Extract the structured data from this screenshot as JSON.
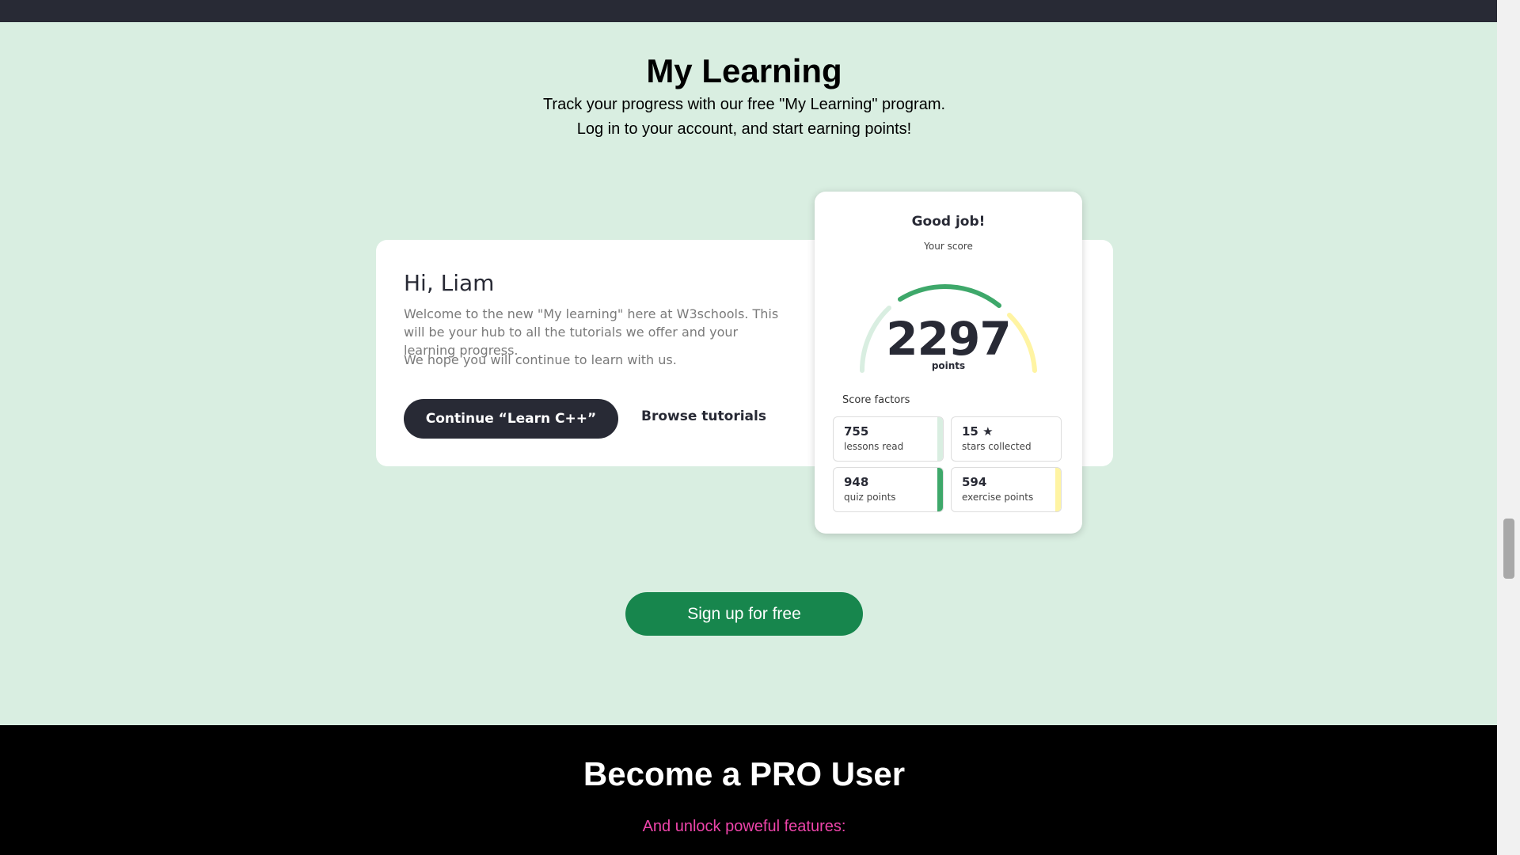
{
  "my_learning": {
    "title": "My Learning",
    "subtitle_line1": "Track your progress with our free \"My Learning\" program.",
    "subtitle_line2": "Log in to your account, and start earning points!"
  },
  "welcome": {
    "greeting": "Hi, Liam",
    "text": "Welcome to the new \"My learning\" here at W3schools. This will be your hub to all the tutorials we offer and your learning progress.",
    "hope": "We hope you will continue to learn with us.",
    "continue_label": "Continue “Learn C++”",
    "browse_label": "Browse tutorials"
  },
  "score": {
    "heading": "Good job!",
    "your_score": "Your score",
    "value": "2297",
    "points_label": "points",
    "factors_title": "Score factors",
    "factors": [
      {
        "value": "755",
        "label": "lessons read",
        "color": "#d9eee1"
      },
      {
        "value": "15",
        "label": "stars collected",
        "color": "#ffffff"
      },
      {
        "value": "948",
        "label": "quiz points",
        "color": "#3ea86a"
      },
      {
        "value": "594",
        "label": "exercise points",
        "color": "#fff4a3"
      }
    ],
    "star_icon": "star-icon"
  },
  "signup": {
    "label": "Sign up for free",
    "color": "#17864d"
  },
  "pro": {
    "title": "Become a PRO User",
    "subtitle": "And unlock poweful features:"
  },
  "colors": {
    "background": "#d9eee1",
    "dark": "#282a35",
    "accent_pink": "#ee44aa"
  }
}
